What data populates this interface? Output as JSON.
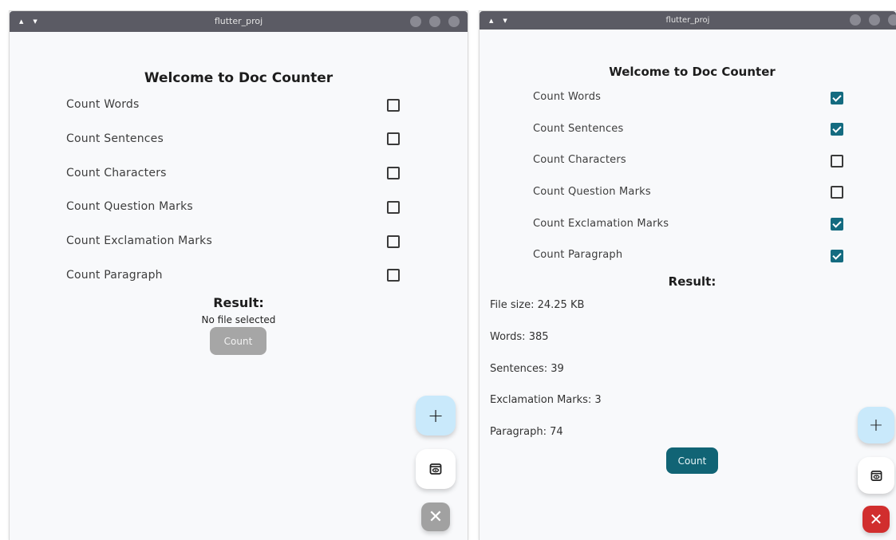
{
  "left_window": {
    "title": "flutter_proj",
    "heading": "Welcome to Doc Counter",
    "options": [
      {
        "label": "Count Words",
        "checked": false
      },
      {
        "label": "Count Sentences",
        "checked": false
      },
      {
        "label": "Count Characters",
        "checked": false
      },
      {
        "label": "Count Question Marks",
        "checked": false
      },
      {
        "label": "Count Exclamation Marks",
        "checked": false
      },
      {
        "label": "Count Paragraph",
        "checked": false
      }
    ],
    "result_title": "Result:",
    "status": "No file selected",
    "count_button": "Count",
    "count_enabled": false,
    "fab_add": "+",
    "fab_close": "✕"
  },
  "right_window": {
    "title": "flutter_proj",
    "heading": "Welcome to Doc Counter",
    "options": [
      {
        "label": "Count Words",
        "checked": true
      },
      {
        "label": "Count Sentences",
        "checked": true
      },
      {
        "label": "Count Characters",
        "checked": false
      },
      {
        "label": "Count Question Marks",
        "checked": false
      },
      {
        "label": "Count Exclamation Marks",
        "checked": true
      },
      {
        "label": "Count Paragraph",
        "checked": true
      }
    ],
    "result_title": "Result:",
    "results": [
      "File size: 24.25 KB",
      "Words: 385",
      "Sentences: 39",
      "Exclamation Marks: 3",
      "Paragraph: 74"
    ],
    "count_button": "Count",
    "count_enabled": true,
    "fab_add": "+",
    "fab_close": "✕"
  },
  "colors": {
    "titlebar": "#5b5b64",
    "checkbox_checked": "#146b80",
    "count_button_enabled": "#116475",
    "count_button_disabled": "#a6a6a6",
    "fab_add": "#c9e9fb",
    "close_red": "#d12e2e",
    "close_grey": "#a1a1a1"
  },
  "icons": {
    "titlebar_arrows": [
      "chevron-up-icon",
      "chevron-down-icon"
    ],
    "fab_add": "plus-icon",
    "fab_view": "preview-icon",
    "fab_close": "close-icon"
  }
}
